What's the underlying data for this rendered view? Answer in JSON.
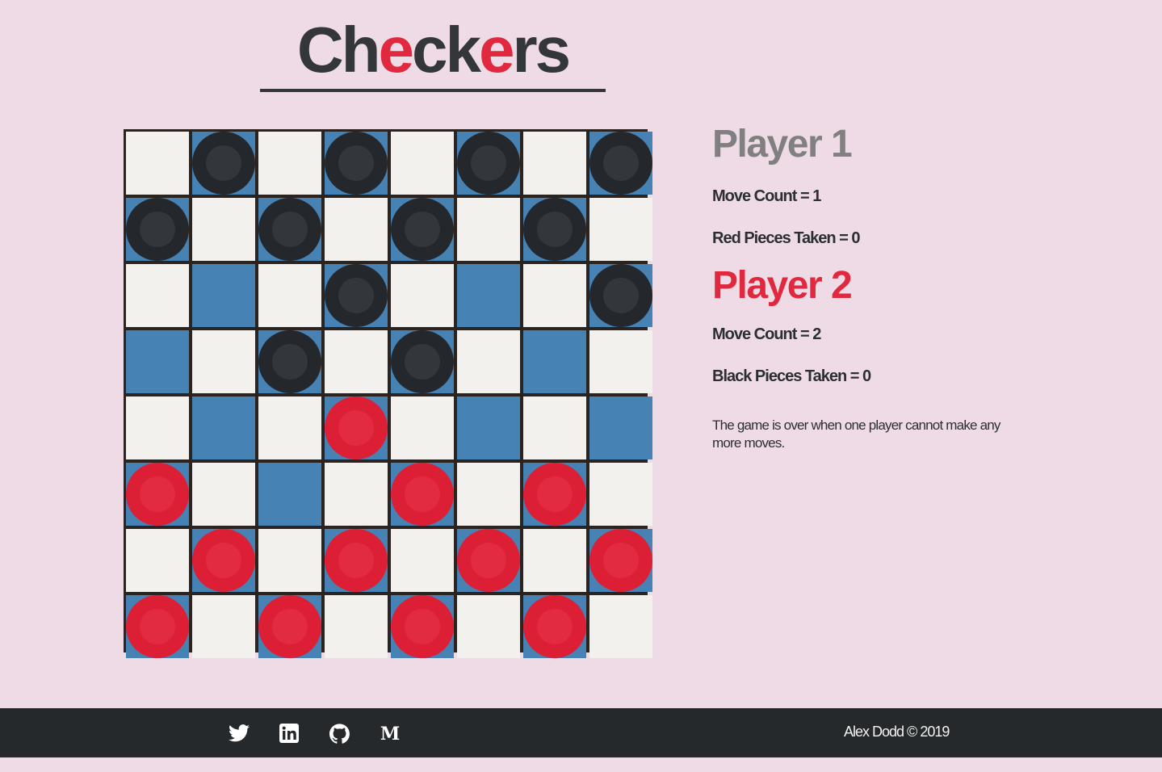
{
  "header": {
    "title_parts": [
      {
        "text": "Ch",
        "accent": false
      },
      {
        "text": "e",
        "accent": true
      },
      {
        "text": "ck",
        "accent": false
      },
      {
        "text": "e",
        "accent": true
      },
      {
        "text": "rs",
        "accent": false
      }
    ]
  },
  "board": {
    "size": 8,
    "pieces": [
      [
        "",
        "b",
        "",
        "b",
        "",
        "b",
        "",
        "b"
      ],
      [
        "b",
        "",
        "b",
        "",
        "b",
        "",
        "b",
        ""
      ],
      [
        "",
        "",
        "",
        "b",
        "",
        "",
        "",
        "b"
      ],
      [
        "",
        "",
        "b",
        "",
        "b",
        "",
        "",
        ""
      ],
      [
        "",
        "",
        "",
        "r",
        "",
        "",
        "",
        ""
      ],
      [
        "r",
        "",
        "",
        "",
        "r",
        "",
        "r",
        ""
      ],
      [
        "",
        "r",
        "",
        "r",
        "",
        "r",
        "",
        "r"
      ],
      [
        "r",
        "",
        "r",
        "",
        "r",
        "",
        "r",
        ""
      ]
    ]
  },
  "colors": {
    "background": "#eedbe5",
    "light_square": "#f2f1ee",
    "dark_square": "#4682b4",
    "black_piece": "#24272b",
    "red_piece": "#dc1f35",
    "accent": "#e0283f",
    "footer": "#25292b"
  },
  "player1": {
    "heading": "Player 1",
    "move_count": "Move Count = 1",
    "pieces_taken": "Red Pieces Taken = 0"
  },
  "player2": {
    "heading": "Player 2",
    "move_count": "Move Count = 2",
    "pieces_taken": "Black Pieces Taken = 0"
  },
  "note": "The game is over when one player cannot make any more moves.",
  "footer": {
    "icons": [
      "twitter-icon",
      "linkedin-icon",
      "github-icon",
      "medium-icon"
    ],
    "copyright": "Alex Dodd © 2019"
  }
}
